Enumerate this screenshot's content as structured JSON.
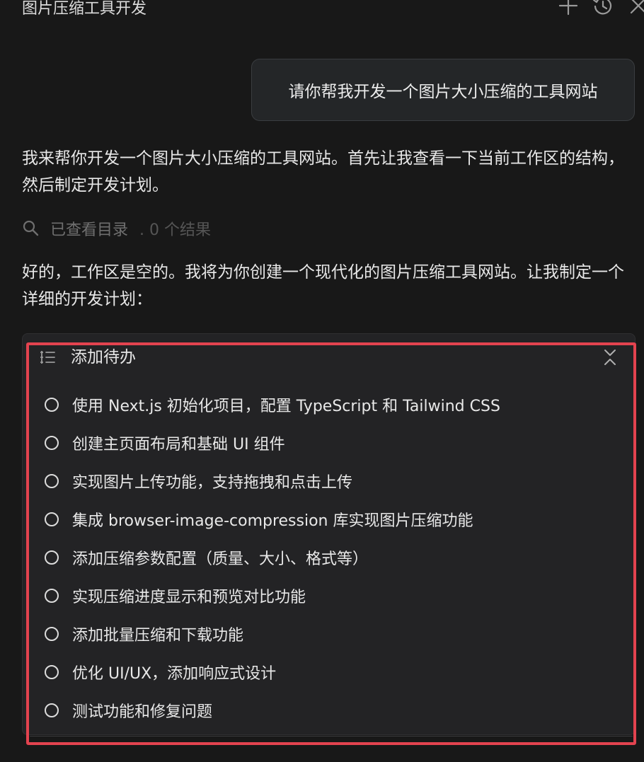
{
  "header": {
    "title": "图片压缩工具开发",
    "icons": [
      "plus-icon",
      "history-icon",
      "close-icon"
    ]
  },
  "conversation": {
    "user_message": "请你帮我开发一个图片大小压缩的工具网站",
    "assistant_message_1": "我来帮你开发一个图片大小压缩的工具网站。首先让我查看一下当前工作区的结构，然后制定开发计划。",
    "tool_call": {
      "label": "已查看目录",
      "meta": ". 0 个结果"
    },
    "assistant_message_2": "好的，工作区是空的。我将为你创建一个现代化的图片压缩工具网站。让我制定一个详细的开发计划："
  },
  "todo": {
    "title": "添加待办",
    "items": [
      {
        "text": "使用 Next.js 初始化项目，配置 TypeScript 和 Tailwind CSS",
        "done": false
      },
      {
        "text": "创建主页面布局和基础 UI 组件",
        "done": false
      },
      {
        "text": "实现图片上传功能，支持拖拽和点击上传",
        "done": false
      },
      {
        "text": "集成 browser-image-compression 库实现图片压缩功能",
        "done": false
      },
      {
        "text": "添加压缩参数配置（质量、大小、格式等）",
        "done": false
      },
      {
        "text": "实现压缩进度显示和预览对比功能",
        "done": false
      },
      {
        "text": "添加批量压缩和下载功能",
        "done": false
      },
      {
        "text": "优化 UI/UX，添加响应式设计",
        "done": false
      },
      {
        "text": "测试功能和修复问题",
        "done": false
      }
    ]
  },
  "colors": {
    "background": "#181818",
    "bubble": "#242628",
    "panel": "#232325",
    "highlight": "#e3434f",
    "muted_text": "#6f6f6f"
  }
}
